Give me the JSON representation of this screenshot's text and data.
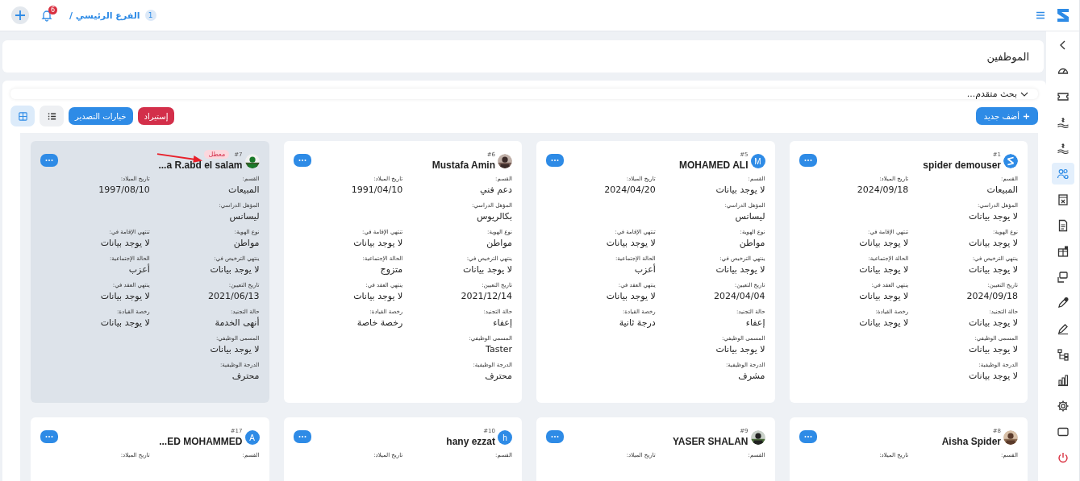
{
  "topbar": {
    "branch_number": "1",
    "branch": "الفرع الرئيسي /",
    "notifications": "6"
  },
  "page_title": "الموظفين",
  "advanced_search": "بحث متقدم...",
  "toolbar": {
    "add": "أضف جديد",
    "import": "إستيراد",
    "export": "خيارات التصدير",
    "view_toggles": [
      {
        "kind": "list",
        "selected": false
      },
      {
        "kind": "grid",
        "selected": true
      }
    ]
  },
  "employees": [
    {
      "number": "#1",
      "name": "spider demouser",
      "avatar": {
        "kind": "logo"
      },
      "disabled": false,
      "rows": [
        {
          "fields": [
            {
              "label": "القسم:",
              "value": "المبيعات"
            },
            {
              "label": "تاريخ الميلاد:",
              "value": "2024/09/18"
            }
          ]
        },
        {
          "fields": [
            {
              "label": "المؤهل الدراسي:",
              "value": "لا يوجد بيانات"
            }
          ]
        },
        {
          "fields": [
            {
              "label": "نوع الهوية:",
              "value": "لا يوجد بيانات"
            },
            {
              "label": "تنتهي الإقامة في:",
              "value": "لا يوجد بيانات"
            }
          ]
        },
        {
          "fields": [
            {
              "label": "ينتهي الترخيص في:",
              "value": "لا يوجد بيانات"
            },
            {
              "label": "الحالة الإجتماعية:",
              "value": "لا يوجد بيانات"
            }
          ]
        },
        {
          "fields": [
            {
              "label": "تاريخ التعيين:",
              "value": "2024/09/18"
            },
            {
              "label": "ينتهي العقد في:",
              "value": "لا يوجد بيانات"
            }
          ]
        },
        {
          "fields": [
            {
              "label": "حالة التجنيد:",
              "value": "لا يوجد بيانات"
            },
            {
              "label": "رخصة القيادة:",
              "value": "لا يوجد بيانات"
            }
          ]
        },
        {
          "fields": [
            {
              "label": "المسمى الوظيفي:",
              "value": "لا يوجد بيانات"
            }
          ]
        },
        {
          "fields": [
            {
              "label": "الدرجة الوظيفية:",
              "value": "لا يوجد بيانات"
            }
          ]
        }
      ]
    },
    {
      "number": "#5",
      "name": "MOHAMED ALI",
      "avatar": {
        "kind": "letter",
        "letter": "M"
      },
      "disabled": false,
      "rows": [
        {
          "fields": [
            {
              "label": "القسم:",
              "value": "لا يوجد بيانات"
            },
            {
              "label": "تاريخ الميلاد:",
              "value": "2024/04/20"
            }
          ]
        },
        {
          "fields": [
            {
              "label": "المؤهل الدراسي:",
              "value": "ليسانس"
            }
          ]
        },
        {
          "fields": [
            {
              "label": "نوع الهوية:",
              "value": "مواطن"
            },
            {
              "label": "تنتهي الإقامة في:",
              "value": "لا يوجد بيانات"
            }
          ]
        },
        {
          "fields": [
            {
              "label": "ينتهي الترخيص في:",
              "value": "لا يوجد بيانات"
            },
            {
              "label": "الحالة الإجتماعية:",
              "value": "أعزب"
            }
          ]
        },
        {
          "fields": [
            {
              "label": "تاريخ التعيين:",
              "value": "2024/04/04"
            },
            {
              "label": "ينتهي العقد في:",
              "value": "لا يوجد بيانات"
            }
          ]
        },
        {
          "fields": [
            {
              "label": "حالة التجنيد:",
              "value": "إعفاء"
            },
            {
              "label": "رخصة القيادة:",
              "value": "درجة ثانية"
            }
          ]
        },
        {
          "fields": [
            {
              "label": "المسمى الوظيفي:",
              "value": "لا يوجد بيانات"
            }
          ]
        },
        {
          "fields": [
            {
              "label": "الدرجة الوظيفية:",
              "value": "مشرف"
            }
          ]
        }
      ]
    },
    {
      "number": "#6",
      "name": "Mustafa Amin",
      "avatar": {
        "kind": "picture"
      },
      "disabled": false,
      "rows": [
        {
          "fields": [
            {
              "label": "القسم:",
              "value": "دعم فني"
            },
            {
              "label": "تاريخ الميلاد:",
              "value": "1991/04/10"
            }
          ]
        },
        {
          "fields": [
            {
              "label": "المؤهل الدراسي:",
              "value": "بكالريوس"
            }
          ]
        },
        {
          "fields": [
            {
              "label": "نوع الهوية:",
              "value": "مواطن"
            },
            {
              "label": "تنتهي الإقامة في:",
              "value": "لا يوجد بيانات"
            }
          ]
        },
        {
          "fields": [
            {
              "label": "ينتهي الترخيص في:",
              "value": "لا يوجد بيانات"
            },
            {
              "label": "الحالة الإجتماعية:",
              "value": "متزوج"
            }
          ]
        },
        {
          "fields": [
            {
              "label": "تاريخ التعيين:",
              "value": "2021/12/14"
            },
            {
              "label": "ينتهي العقد في:",
              "value": "لا يوجد بيانات"
            }
          ]
        },
        {
          "fields": [
            {
              "label": "حالة التجنيد:",
              "value": "إعفاء"
            },
            {
              "label": "رخصة القيادة:",
              "value": "رخصة خاصة"
            }
          ]
        },
        {
          "fields": [
            {
              "label": "المسمى الوظيفي:",
              "value": "Taster"
            }
          ]
        },
        {
          "fields": [
            {
              "label": "الدرجة الوظيفية:",
              "value": "محترف"
            }
          ]
        }
      ]
    },
    {
      "number": "#7",
      "name": "...a R.abd el salam",
      "avatar": {
        "kind": "picture"
      },
      "disabled": true,
      "status_badge": "معطل",
      "annotation_arrow": true,
      "rows": [
        {
          "fields": [
            {
              "label": "القسم:",
              "value": "المبيعات"
            },
            {
              "label": "تاريخ الميلاد:",
              "value": "1997/08/10"
            }
          ]
        },
        {
          "fields": [
            {
              "label": "المؤهل الدراسي:",
              "value": "ليسانس"
            }
          ]
        },
        {
          "fields": [
            {
              "label": "نوع الهوية:",
              "value": "مواطن"
            },
            {
              "label": "تنتهي الإقامة في:",
              "value": "لا يوجد بيانات"
            }
          ]
        },
        {
          "fields": [
            {
              "label": "ينتهي الترخيص في:",
              "value": "لا يوجد بيانات"
            },
            {
              "label": "الحالة الإجتماعية:",
              "value": "أعزب"
            }
          ]
        },
        {
          "fields": [
            {
              "label": "تاريخ التعيين:",
              "value": "2021/06/13"
            },
            {
              "label": "ينتهي العقد في:",
              "value": "لا يوجد بيانات"
            }
          ]
        },
        {
          "fields": [
            {
              "label": "حالة التجنيد:",
              "value": "أنهى الخدمة"
            },
            {
              "label": "رخصة القيادة:",
              "value": "لا يوجد بيانات"
            }
          ]
        },
        {
          "fields": [
            {
              "label": "المسمى الوظيفي:",
              "value": "لا يوجد بيانات"
            }
          ]
        },
        {
          "fields": [
            {
              "label": "الدرجة الوظيفية:",
              "value": "محترف"
            }
          ]
        }
      ]
    },
    {
      "number": "#8",
      "name": "Aisha Spider",
      "avatar": {
        "kind": "picture"
      },
      "disabled": false,
      "rows": [
        {
          "fields": [
            {
              "label": "القسم:"
            },
            {
              "label": "تاريخ الميلاد:"
            }
          ]
        }
      ]
    },
    {
      "number": "#9",
      "name": "YASER SHALAN",
      "avatar": {
        "kind": "picture"
      },
      "disabled": false,
      "rows": [
        {
          "fields": [
            {
              "label": "القسم:"
            },
            {
              "label": "تاريخ الميلاد:"
            }
          ]
        }
      ]
    },
    {
      "number": "#10",
      "name": "hany ezzat",
      "avatar": {
        "kind": "letter",
        "letter": "h"
      },
      "disabled": false,
      "rows": [
        {
          "fields": [
            {
              "label": "القسم:"
            },
            {
              "label": "تاريخ الميلاد:"
            }
          ]
        }
      ]
    },
    {
      "number": "#17",
      "name": "...ED MOHAMMED",
      "avatar": {
        "kind": "letter",
        "letter": "A"
      },
      "disabled": false,
      "rows": [
        {
          "fields": [
            {
              "label": "القسم:"
            },
            {
              "label": "تاريخ الميلاد:"
            }
          ]
        }
      ]
    }
  ],
  "sidebar": {
    "items": [
      {
        "selected": false
      },
      {
        "selected": false
      },
      {
        "selected": false
      },
      {
        "selected": false
      },
      {
        "selected": false
      },
      {
        "selected": true
      },
      {
        "selected": false
      },
      {
        "selected": false
      },
      {
        "selected": false
      },
      {
        "selected": false
      },
      {
        "selected": false
      },
      {
        "selected": false
      },
      {
        "selected": false
      },
      {
        "selected": false
      },
      {
        "selected": false
      },
      {
        "selected": false
      },
      {
        "selected": false
      }
    ]
  }
}
